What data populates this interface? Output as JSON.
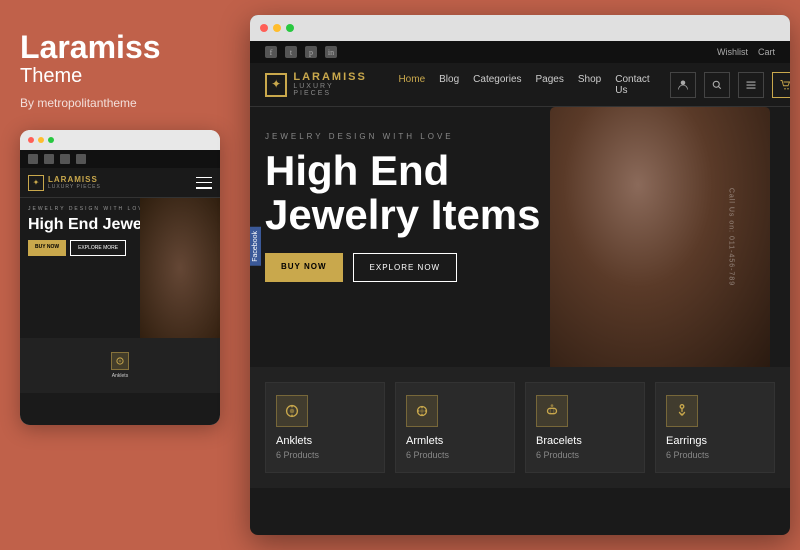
{
  "left": {
    "title": "Laramiss",
    "subtitle": "Theme",
    "by": "By metropolitantheme"
  },
  "mobile": {
    "logo": "LARAMISS",
    "logo_sub": "LUXURY PIECES",
    "hero_label": "JEWELRY DESIGN WITH LOVE",
    "hero_title": "High End Jewelry Items",
    "btn_primary": "BUY NOW",
    "btn_secondary": "EXPLORE MORE"
  },
  "desktop": {
    "chrome_dots": [
      "red",
      "yellow",
      "green"
    ],
    "social_links": [
      "f",
      "t",
      "p",
      "in"
    ],
    "wishlist": "Wishlist",
    "cart": "Cart",
    "logo": "LARAMISS",
    "logo_sub": "LUXURY PIECES",
    "nav_links": [
      {
        "label": "Home",
        "active": true
      },
      {
        "label": "Blog",
        "active": false
      },
      {
        "label": "Categories",
        "active": false
      },
      {
        "label": "Pages",
        "active": false
      },
      {
        "label": "Shop",
        "active": false
      },
      {
        "label": "Contact Us",
        "active": false
      }
    ],
    "hero_label": "JEWELRY DESIGN WITH LOVE",
    "hero_title": "High End Jewelry Items",
    "btn_primary": "BUY NOW",
    "btn_secondary": "EXPLORE NOW",
    "side_text": "Call Us on: 011-456-789",
    "facebook_tab": "Facebook",
    "categories": [
      {
        "name": "Anklets",
        "count": "6 Products"
      },
      {
        "name": "Armlets",
        "count": "6 Products"
      },
      {
        "name": "Bracelets",
        "count": "6 Products"
      },
      {
        "name": "Earrings",
        "count": "6 Products"
      }
    ]
  }
}
